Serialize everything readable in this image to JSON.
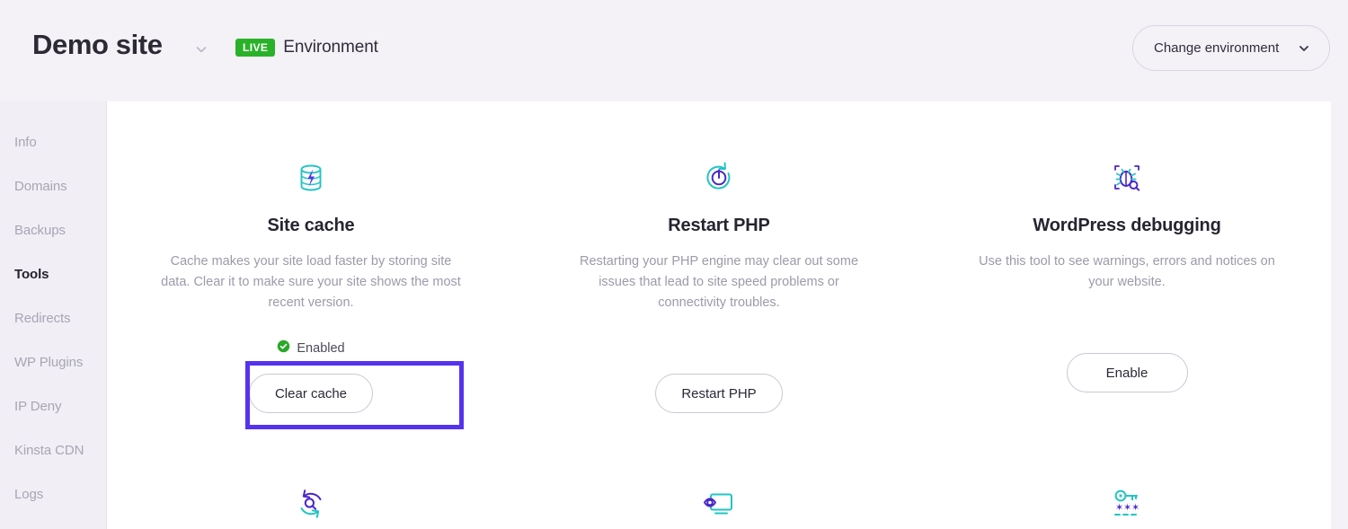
{
  "header": {
    "site_title": "Demo site",
    "site_dropdown_icon": "chevron-down-icon",
    "environment_badge": "LIVE",
    "environment_label": "Environment",
    "change_environment_label": "Change environment",
    "change_environment_icon": "chevron-down-icon"
  },
  "sidebar": {
    "items": [
      {
        "label": "Info",
        "active": false
      },
      {
        "label": "Domains",
        "active": false
      },
      {
        "label": "Backups",
        "active": false
      },
      {
        "label": "Tools",
        "active": true
      },
      {
        "label": "Redirects",
        "active": false
      },
      {
        "label": "WP Plugins",
        "active": false
      },
      {
        "label": "IP Deny",
        "active": false
      },
      {
        "label": "Kinsta CDN",
        "active": false
      },
      {
        "label": "Logs",
        "active": false
      }
    ]
  },
  "main": {
    "tools": [
      {
        "icon": "database-lightning-icon",
        "title": "Site cache",
        "description": "Cache makes your site load faster by storing site data. Clear it to make sure your site shows the most recent version.",
        "status": "Enabled",
        "status_icon": "check-circle-icon",
        "button_label": "Clear cache",
        "highlighted": true
      },
      {
        "icon": "restart-power-icon",
        "title": "Restart PHP",
        "description": "Restarting your PHP engine may clear out some issues that lead to site speed problems or connectivity troubles.",
        "status": "",
        "status_icon": "",
        "button_label": "Restart PHP",
        "highlighted": false
      },
      {
        "icon": "bug-search-icon",
        "title": "WordPress debugging",
        "description": "Use this tool to see warnings, errors and notices on your website.",
        "status": "",
        "status_icon": "",
        "button_label": "Enable",
        "highlighted": false
      }
    ],
    "tools_row2": [
      {
        "icon": "search-replace-icon"
      },
      {
        "icon": "eye-monitor-icon"
      },
      {
        "icon": "key-password-icon"
      }
    ]
  },
  "colors": {
    "accent_purple": "#5533ee",
    "accent_cyan": "#22c4c4",
    "live_green": "#29b229",
    "page_bg": "#f4f2f7",
    "panel_bg": "#ffffff",
    "muted_text": "#9d9aa9"
  }
}
